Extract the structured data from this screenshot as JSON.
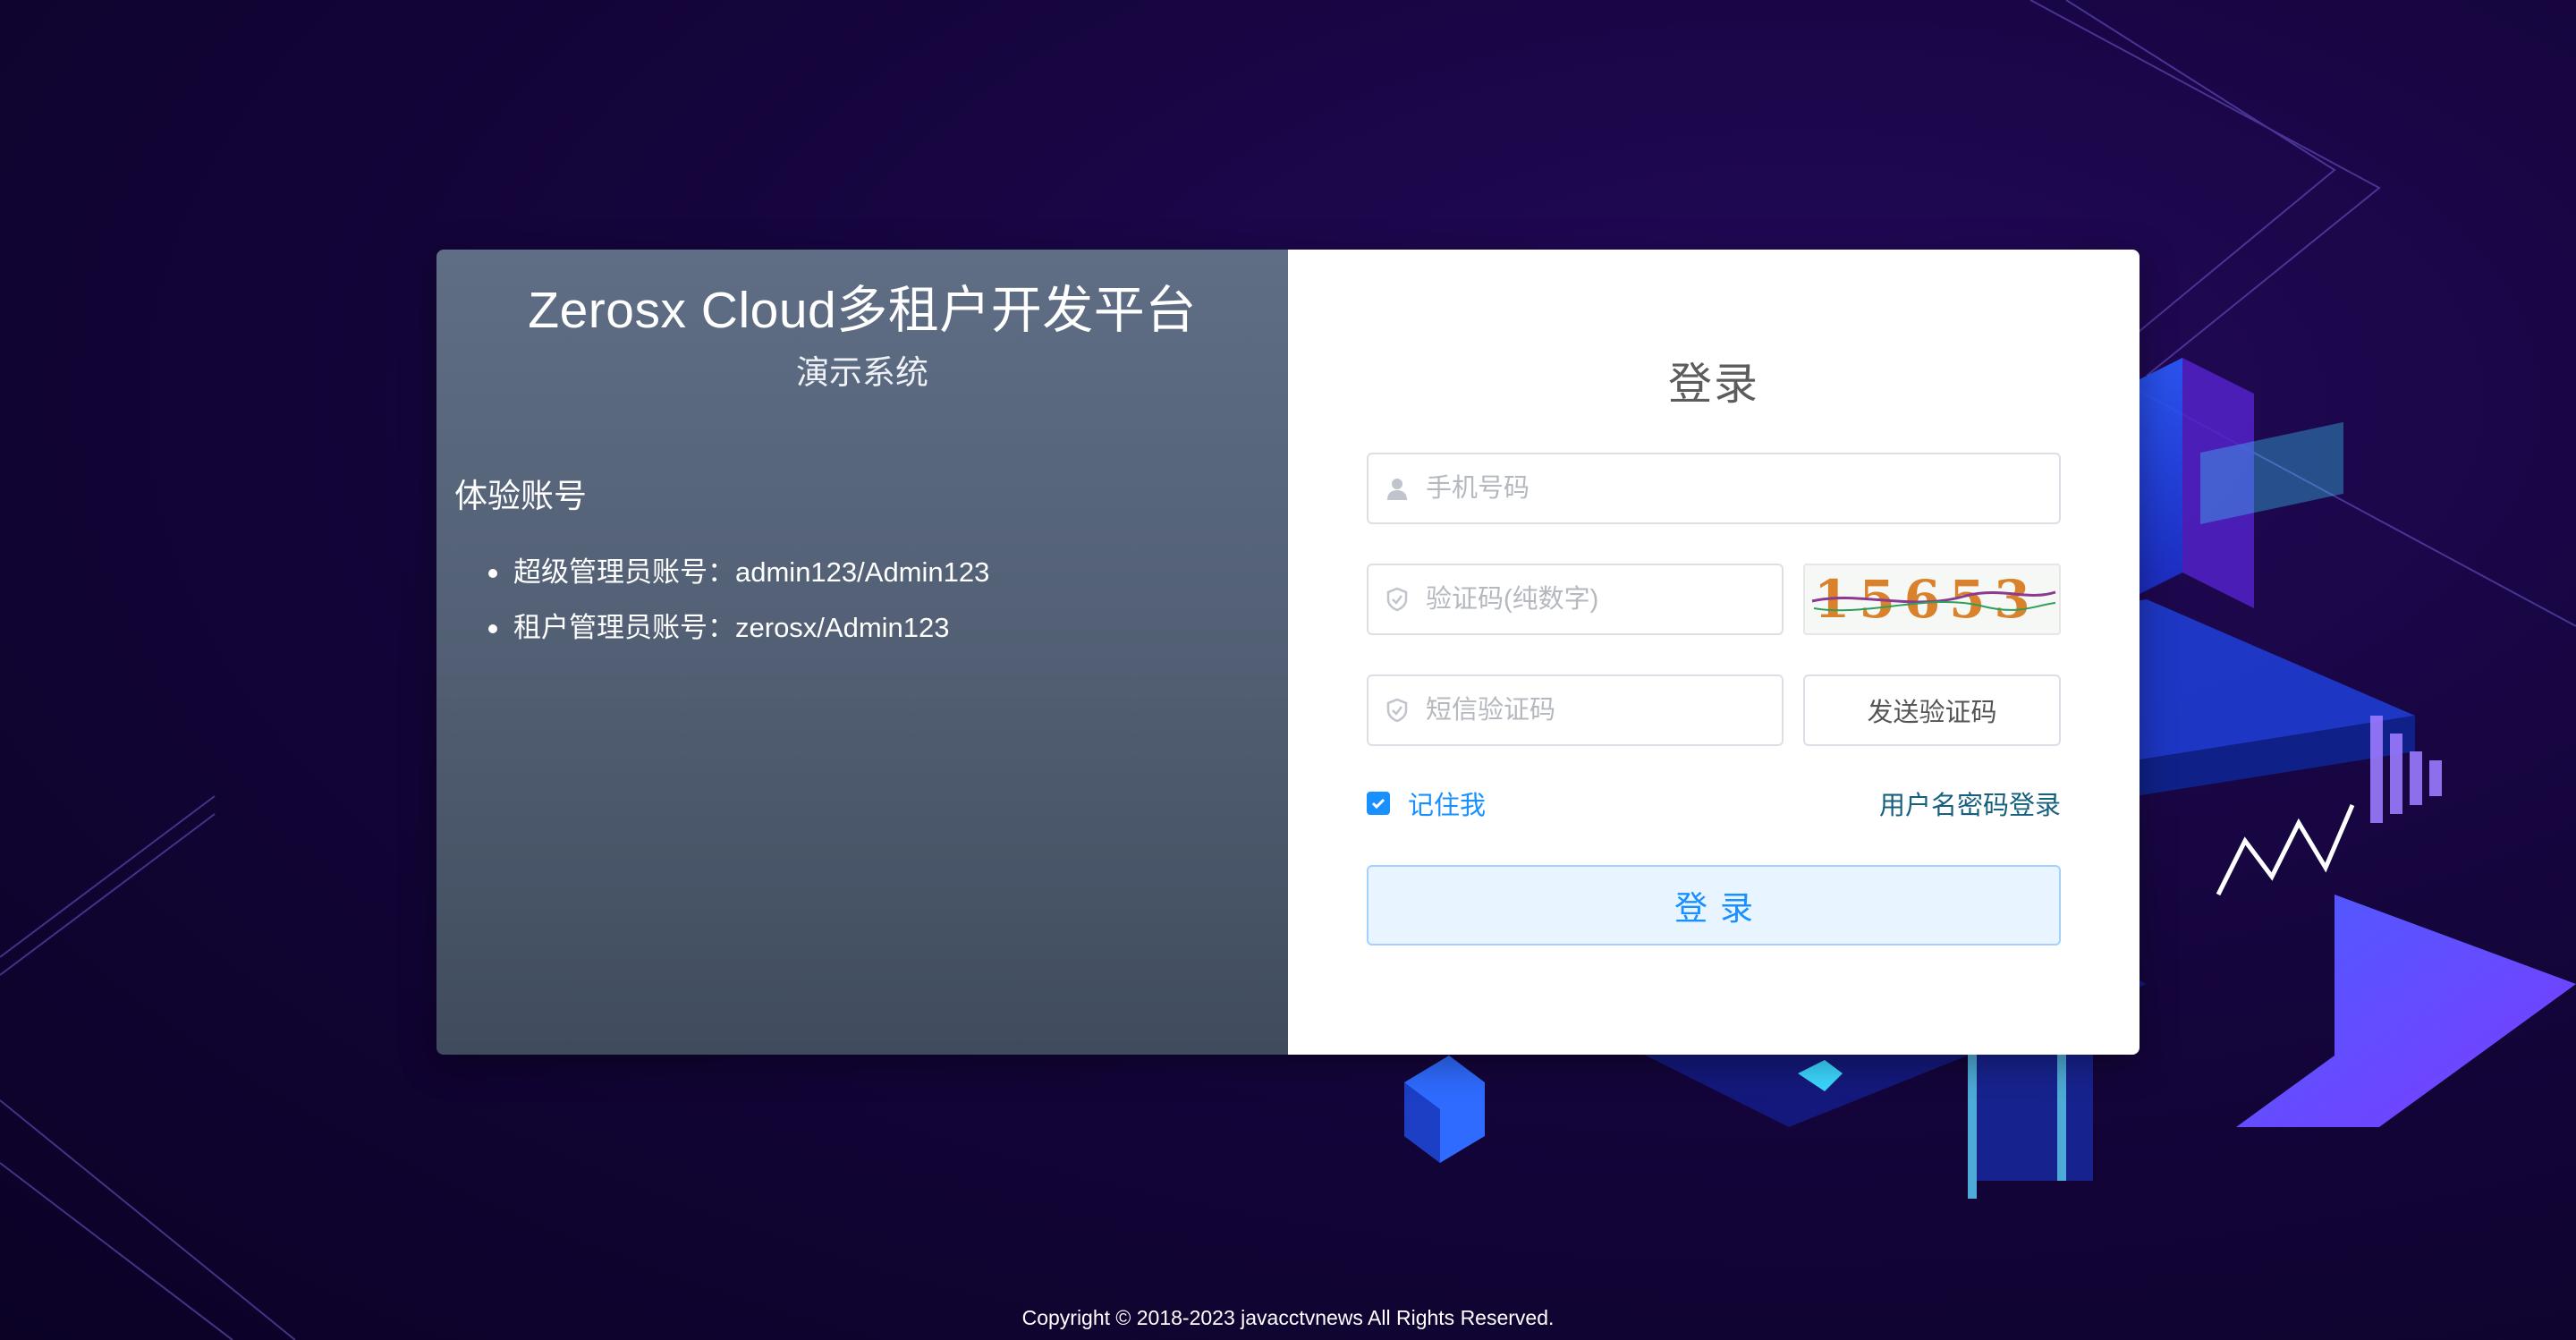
{
  "brand": {
    "title": "Zerosx Cloud多租户开发平台",
    "subtitle": "演示系统"
  },
  "accounts": {
    "title": "体验账号",
    "items": [
      "超级管理员账号：admin123/Admin123",
      "租户管理员账号：zerosx/Admin123"
    ]
  },
  "login": {
    "title": "登录",
    "phone_placeholder": "手机号码",
    "phone_icon": "user-icon",
    "captcha_placeholder": "验证码(纯数字)",
    "captcha_icon": "shield-icon",
    "captcha_text": "15653",
    "sms_placeholder": "短信验证码",
    "sms_icon": "shield-icon",
    "send_code_label": "发送验证码",
    "remember_label": "记住我",
    "remember_checked": true,
    "switch_label": "用户名密码登录",
    "submit_label": "登录"
  },
  "footer": {
    "copyright": "Copyright © 2018-2023 javacctvnews All Rights Reserved."
  },
  "colors": {
    "accent": "#1890ff",
    "panel_top": "#5f6e85",
    "panel_bottom": "#404c5d",
    "background": "#15053d"
  }
}
